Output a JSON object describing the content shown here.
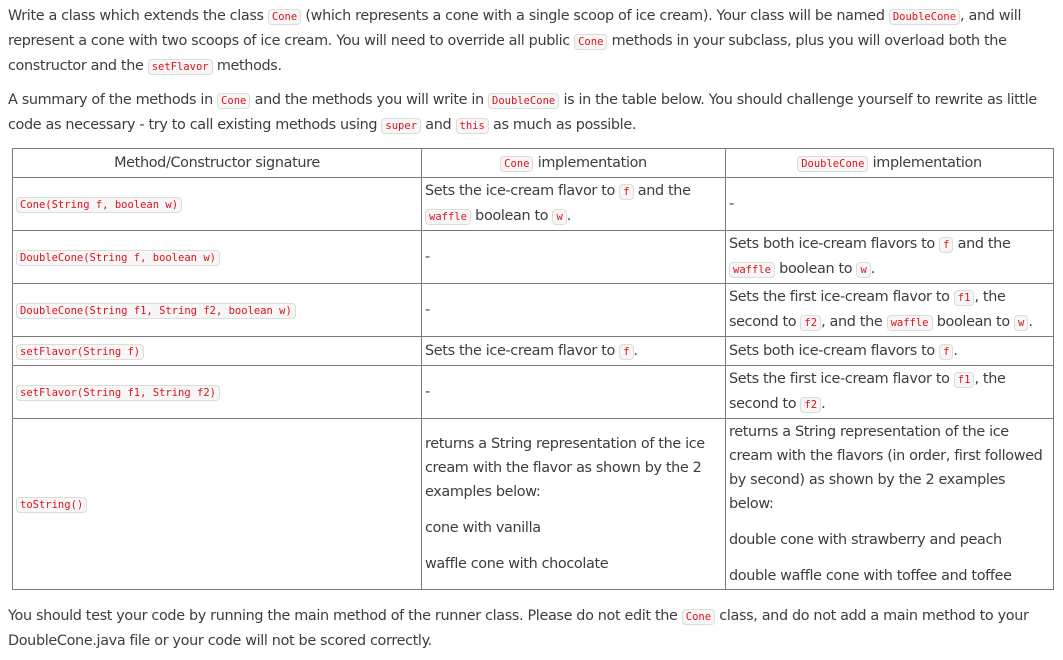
{
  "intro": {
    "p1": {
      "t1": "Write a class which extends the class ",
      "c1": "Cone",
      "t2": " (which represents a cone with a single scoop of ice cream). Your class will be named ",
      "c2": "DoubleCone",
      "t3": ", and will represent a cone with two scoops of ice cream. You will need to override all public ",
      "c3": "Cone",
      "t4": " methods in your subclass, plus you will overload both the constructor and the ",
      "c4": "setFlavor",
      "t5": " methods."
    },
    "p2": {
      "t1": "A summary of the methods in ",
      "c1": "Cone",
      "t2": " and the methods you will write in ",
      "c2": "DoubleCone",
      "t3": " is in the table below. You should challenge yourself to rewrite as little code as necessary - try to call existing methods using ",
      "c3": "super",
      "t4": " and ",
      "c4": "this",
      "t5": " as much as possible."
    }
  },
  "table": {
    "headers": {
      "col1": "Method/Constructor signature",
      "col2_code": "Cone",
      "col2_text": " implementation",
      "col3_code": "DoubleCone",
      "col3_text": " implementation"
    },
    "rows": [
      {
        "signature": "Cone(String f, boolean w)",
        "cone": {
          "t1": "Sets the ice-cream flavor to ",
          "c1": "f",
          "t2": " and the ",
          "c2": "waffle",
          "t3": " boolean to ",
          "c3": "w",
          "t4": "."
        },
        "double": "-"
      },
      {
        "signature": "DoubleCone(String f, boolean w)",
        "cone": "-",
        "double": {
          "t1": "Sets both ice-cream flavors to ",
          "c1": "f",
          "t2": " and the ",
          "c2": "waffle",
          "t3": " boolean to ",
          "c3": "w",
          "t4": "."
        }
      },
      {
        "signature": "DoubleCone(String f1, String f2, boolean w)",
        "cone": "-",
        "double": {
          "t1": "Sets the first ice-cream flavor to ",
          "c1": "f1",
          "t2": ", the second to ",
          "c2": "f2",
          "t3": ", and the ",
          "c3": "waffle",
          "t4": " boolean to ",
          "c4": "w",
          "t5": "."
        }
      },
      {
        "signature": "setFlavor(String f)",
        "cone": {
          "t1": "Sets the ice-cream flavor to ",
          "c1": "f",
          "t2": "."
        },
        "double": {
          "t1": "Sets both ice-cream flavors to ",
          "c1": "f",
          "t2": "."
        }
      },
      {
        "signature": "setFlavor(String f1, String f2)",
        "cone": "-",
        "double": {
          "t1": "Sets the first ice-cream flavor to ",
          "c1": "f1",
          "t2": ", the second to ",
          "c2": "f2",
          "t3": "."
        }
      },
      {
        "signature": "toString()",
        "cone": {
          "desc": "returns a String representation of the ice cream with the flavor as shown by the 2 examples below:",
          "examples": [
            "cone with vanilla",
            "waffle cone with chocolate"
          ]
        },
        "double": {
          "desc": "returns a String representation of the ice cream with the flavors (in order, first followed by second) as shown by the 2 examples below:",
          "examples": [
            "double cone with strawberry and peach",
            "double waffle cone with toffee and toffee"
          ]
        }
      }
    ]
  },
  "footer": {
    "t1": "You should test your code by running the main method of the runner class. Please do not edit the ",
    "c1": "Cone",
    "t2": " class, and do not add a main method to your DoubleCone.java file or your code will not be scored correctly."
  }
}
